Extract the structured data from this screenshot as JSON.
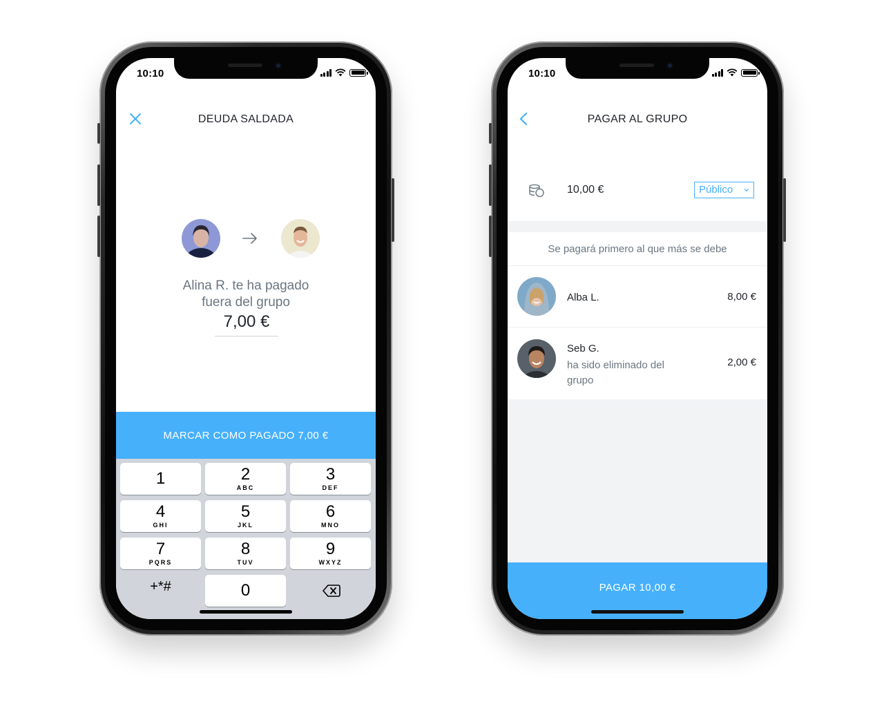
{
  "left_phone": {
    "status_time": "10:10",
    "title": "DEUDA SALDADA",
    "message_line1": "Alina R. te ha pagado",
    "message_line2": "fuera del grupo",
    "amount": "7,00 €",
    "mark_paid_button": "MARCAR COMO PAGADO 7,00 €",
    "keypad": {
      "keys": [
        {
          "digit": "1",
          "letters": ""
        },
        {
          "digit": "2",
          "letters": "ABC"
        },
        {
          "digit": "3",
          "letters": "DEF"
        },
        {
          "digit": "4",
          "letters": "GHI"
        },
        {
          "digit": "5",
          "letters": "JKL"
        },
        {
          "digit": "6",
          "letters": "MNO"
        },
        {
          "digit": "7",
          "letters": "PQRS"
        },
        {
          "digit": "8",
          "letters": "TUV"
        },
        {
          "digit": "9",
          "letters": "WXYZ"
        },
        {
          "digit": "0",
          "letters": ""
        }
      ],
      "symbols_key": "+*#"
    }
  },
  "right_phone": {
    "status_time": "10:10",
    "title": "PAGAR AL GRUPO",
    "pay_amount": "10,00 €",
    "visibility_select": "Público",
    "hint": "Se pagará primero al que más se debe",
    "recipients": [
      {
        "name": "Alba L.",
        "note": "",
        "amount": "8,00 €"
      },
      {
        "name": "Seb G.",
        "note": "ha sido eliminado del grupo",
        "amount": "2,00 €"
      }
    ],
    "pay_button": "PAGAR 10,00 €"
  },
  "colors": {
    "accent": "#46b0fb",
    "text_primary": "#1f2329",
    "text_secondary": "#6b7681",
    "keypad_bg": "#d1d5db",
    "section_gray": "#f2f3f5"
  },
  "icons": {
    "left_nav": "close-icon",
    "right_nav": "back-chevron-icon",
    "transfer": "arrow-right-icon",
    "amount": "coins-icon",
    "delete_key": "backspace-icon"
  }
}
